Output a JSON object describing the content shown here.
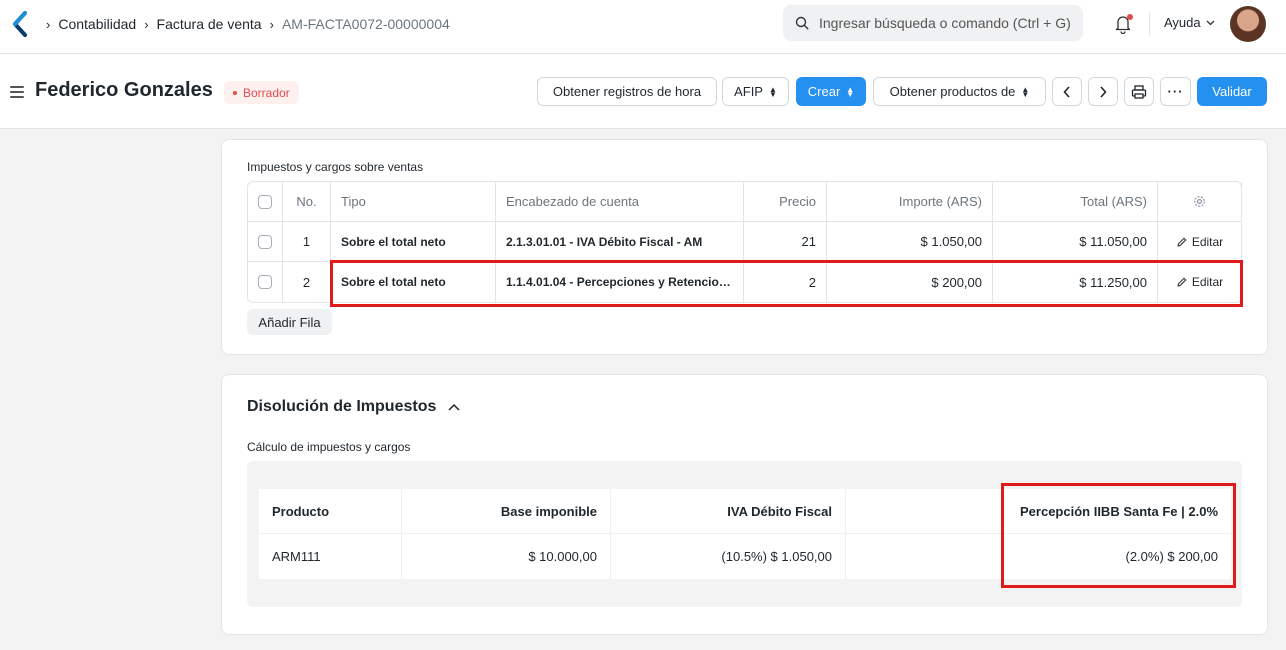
{
  "breadcrumb": {
    "items": [
      "Contabilidad",
      "Factura de venta",
      "AM-FACTA0072-00000004"
    ]
  },
  "search": {
    "placeholder": "Ingresar búsqueda o comando (Ctrl + G)"
  },
  "navbar": {
    "help_label": "Ayuda"
  },
  "header": {
    "title": "Federico Gonzales",
    "status": "Borrador",
    "buttons": {
      "time_logs": "Obtener registros de hora",
      "afip": "AFIP",
      "create": "Crear",
      "get_items": "Obtener productos de",
      "submit": "Validar"
    }
  },
  "taxes": {
    "section_label": "Impuestos y cargos sobre ventas",
    "columns": [
      "No.",
      "Tipo",
      "Encabezado de cuenta",
      "Precio",
      "Importe (ARS)",
      "Total (ARS)"
    ],
    "rows": [
      {
        "no": "1",
        "type": "Sobre el total neto",
        "account": "2.1.3.01.01 - IVA Débito Fiscal - AM",
        "rate": "21",
        "amount": "$ 1.050,00",
        "total": "$ 11.050,00",
        "edit": "Editar"
      },
      {
        "no": "2",
        "type": "Sobre el total neto",
        "account": "1.1.4.01.04 - Percepciones y Retencio…",
        "rate": "2",
        "amount": "$ 200,00",
        "total": "$ 11.250,00",
        "edit": "Editar"
      }
    ],
    "add_row": "Añadir Fila"
  },
  "breakup": {
    "title": "Disolución de Impuestos",
    "subtitle": "Cálculo de impuestos y cargos",
    "columns": [
      "Producto",
      "Base imponible",
      "IVA Débito Fiscal",
      "",
      "Percepción IIBB Santa Fe | 2.0%"
    ],
    "rows": [
      {
        "item": "ARM111",
        "base": "$ 10.000,00",
        "iva": "(10.5%) $ 1.050,00",
        "empty": "",
        "iibb": "(2.0%) $ 200,00"
      }
    ]
  },
  "colors": {
    "primary": "#2490ef",
    "draft": "#e24c4c",
    "highlight": "#e01b1b"
  }
}
